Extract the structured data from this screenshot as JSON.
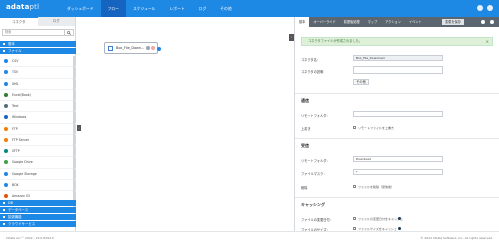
{
  "app": {
    "logo_main": "adata",
    "logo_sub": "ptl",
    "nav": [
      "ダッシュボード",
      "フロー",
      "スケジュール",
      "レポート",
      "ログ",
      "その他"
    ]
  },
  "palette": {
    "tabs": [
      "コネクタ",
      "ログ"
    ],
    "search_placeholder": "検索",
    "categories": {
      "top1": "基本",
      "top2": "ファイル",
      "bottom": [
        "DB",
        "データベース",
        "拡張機能",
        "クラウドサービス"
      ]
    },
    "items": [
      {
        "label": "CSV",
        "color": "#1e88e5"
      },
      {
        "label": "TSV",
        "color": "#1e88e5"
      },
      {
        "label": "XML",
        "color": "#1e88e5"
      },
      {
        "label": "Excel(Book)",
        "color": "#2e7d32"
      },
      {
        "label": "Text",
        "color": "#546e7a"
      },
      {
        "label": "Windows",
        "color": "#1565c0"
      },
      {
        "label": "FTP",
        "color": "#f57c00"
      },
      {
        "label": "FTP Server",
        "color": "#f57c00"
      },
      {
        "label": "SFTP",
        "color": "#00897b"
      },
      {
        "label": "Google Drive",
        "color": "#43a047"
      },
      {
        "label": "Google Storage",
        "color": "#1e88e5"
      },
      {
        "label": "BOX",
        "color": "#1e88e5"
      },
      {
        "label": "Amazon S3",
        "color": "#e65100"
      }
    ]
  },
  "canvas": {
    "node_label": "Box_File_Down..."
  },
  "properties": {
    "tabs": [
      "基本",
      "オーバーライド",
      "前提後処理",
      "マップ",
      "アクション",
      "イベント"
    ],
    "action_label": "変更を保存",
    "alert": "コネクタファイルが作成されました。",
    "name_label": "コネクタ名：",
    "name_value": "Box_File_Download",
    "desc_label": "コネクタの説明：",
    "desc_value": "",
    "detail_button": "その他",
    "section_common": "通信",
    "folder_label": "リモートフォルダ：",
    "folder_value": "",
    "overwrite_label": "上書き",
    "overwrite_cb": "リモートファイルを上書き",
    "section_receive": "受信",
    "recv_folder_label": "リモートフォルダ：",
    "recv_folder_value": "Download",
    "file_label": "ファイルマスク：",
    "file_value": "*",
    "delete_label": "削除",
    "delete_cb": "ファイルを削除（受信後）",
    "section_cache": "キャッシング",
    "cache1_label": "ファイルの変更日付：",
    "cache1_cb": "ファイルの変更日付をキャッシュ",
    "cache2_label": "ファイルのサイズ：",
    "cache2_cb": "ファイルサイズをキャッシュ"
  },
  "footer": {
    "left": "CData Arc™ 2022 - 22.0.8294.0",
    "right": "© 2022 CData Software, Inc. All rights reserved."
  }
}
